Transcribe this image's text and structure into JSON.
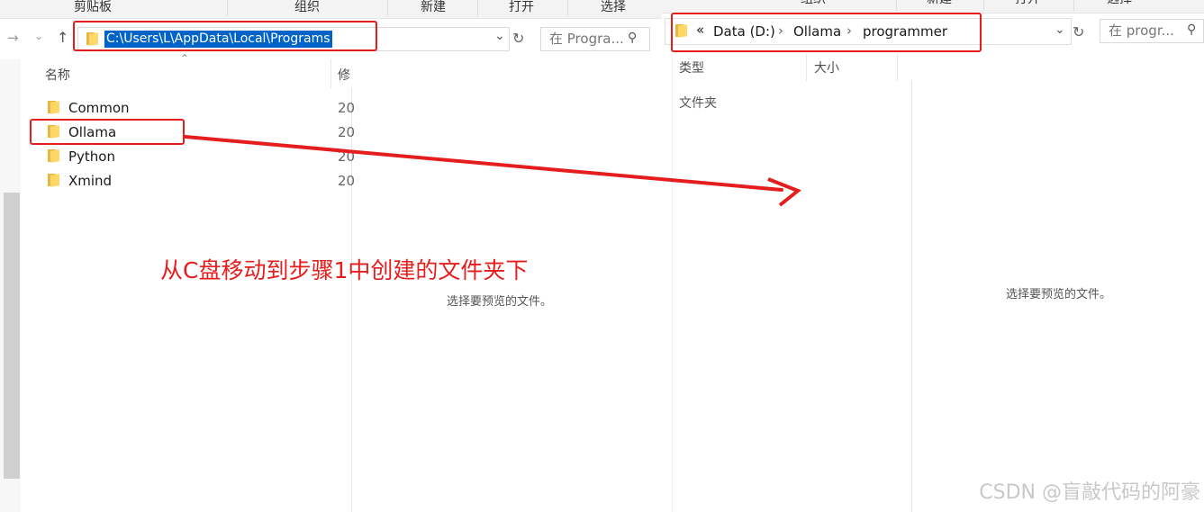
{
  "left_window": {
    "ribbon_groups": [
      "剪贴板",
      "组织",
      "新建",
      "打开",
      "选择"
    ],
    "address_path": "C:\\Users\\L\\AppData\\Local\\Programs",
    "search_placeholder": "在 Progra...",
    "columns": {
      "name": "名称",
      "modified": "修"
    },
    "rows": [
      {
        "name": "Common",
        "date": "20"
      },
      {
        "name": "Ollama",
        "date": "20"
      },
      {
        "name": "Python",
        "date": "20"
      },
      {
        "name": "Xmind",
        "date": "20"
      }
    ],
    "preview_text": "选择要预览的文件。"
  },
  "right_window": {
    "ribbon_groups": [
      "组织",
      "新建",
      "打开",
      "选择"
    ],
    "breadcrumb_prefix": "«",
    "breadcrumb": [
      "Data (D:)",
      "Ollama",
      "programmer"
    ],
    "search_placeholder": "在 progr...",
    "columns": {
      "type": "类型",
      "size": "大小"
    },
    "rows": [
      {
        "type": "文件夹"
      }
    ],
    "preview_text": "选择要预览的文件。"
  },
  "annotation": {
    "text": "从C盘移动到步骤1中创建的文件夹下",
    "color": "#e51d1d"
  },
  "watermark": "CSDN @盲敲代码的阿豪",
  "colors": {
    "selection": "#0063c8",
    "annotation_red": "#e51d1d",
    "folder_yellow": "#ffd766"
  },
  "icons": {
    "address_folder": "folder-icon",
    "nav_back": "arrow-right-icon",
    "nav_dropdown": "chevron-down-icon",
    "nav_up": "arrow-up-icon",
    "refresh": "refresh-icon",
    "search": "search-icon",
    "sort": "sort-up-icon"
  }
}
